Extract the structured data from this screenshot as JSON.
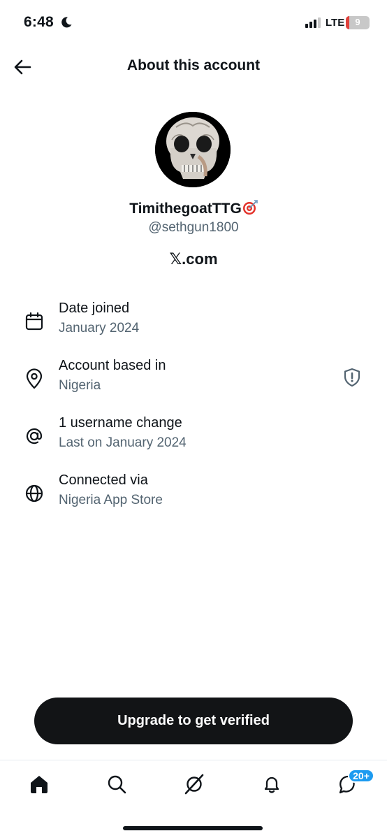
{
  "status_bar": {
    "time": "6:48",
    "network": "LTE",
    "battery": "9"
  },
  "header": {
    "title": "About this account"
  },
  "profile": {
    "display_name": "TimithegoatTTG",
    "handle": "@sethgun1800",
    "platform": "𝕏.com"
  },
  "info": [
    {
      "label": "Date joined",
      "value": "January 2024",
      "icon": "calendar-icon"
    },
    {
      "label": "Account based in",
      "value": "Nigeria",
      "icon": "location-pin-icon"
    },
    {
      "label": "1 username change",
      "value": "Last on January 2024",
      "icon": "at-sign-icon"
    },
    {
      "label": "Connected via",
      "value": "Nigeria App Store",
      "icon": "globe-icon"
    }
  ],
  "upgrade": {
    "label": "Upgrade to get verified"
  },
  "nav": {
    "items": [
      "home-icon",
      "search-icon",
      "grok-icon",
      "notifications-icon",
      "messages-icon"
    ],
    "messages_badge": "20+"
  },
  "colors": {
    "text": "#0f1419",
    "secondary_text": "#536471",
    "button_bg": "#121416",
    "badge": "#1d9bf0",
    "battery_low": "#e0413b"
  }
}
